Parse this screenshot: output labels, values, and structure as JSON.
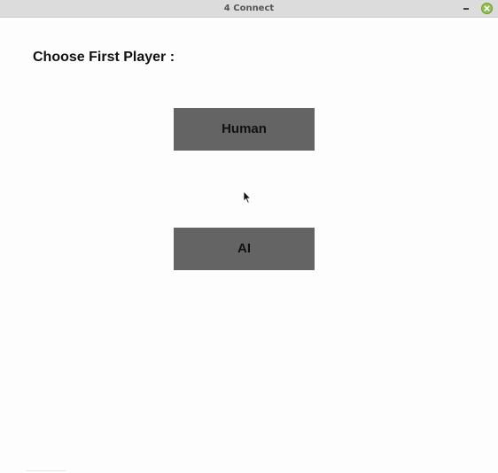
{
  "window": {
    "title": "4 Connect"
  },
  "main": {
    "heading": "Choose First Player :",
    "buttons": [
      {
        "label": "Human"
      },
      {
        "label": "AI"
      }
    ]
  },
  "colors": {
    "button_bg": "#646464",
    "titlebar_bg": "#dcdcdc",
    "close_button": "#8fc24a"
  },
  "icons": {
    "minimize": "minimize-icon",
    "close": "close-icon",
    "cursor": "mouse-pointer-icon"
  }
}
